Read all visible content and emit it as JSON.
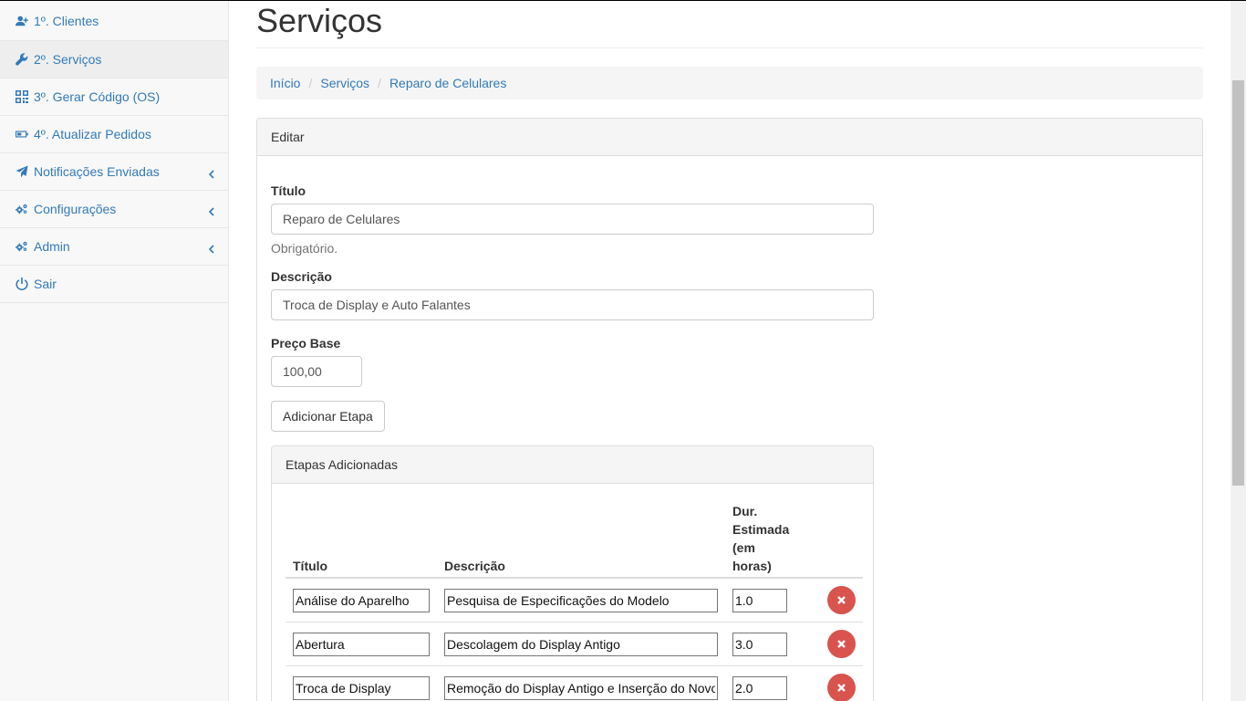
{
  "sidebar": {
    "items": [
      {
        "label": "1º. Clientes",
        "icon": "user-plus-icon",
        "active": false,
        "caret": false
      },
      {
        "label": "2º. Serviços",
        "icon": "wrench-icon",
        "active": true,
        "caret": false
      },
      {
        "label": "3º. Gerar Código (OS)",
        "icon": "qrcode-icon",
        "active": false,
        "caret": false
      },
      {
        "label": "4º. Atualizar Pedidos",
        "icon": "battery-icon",
        "active": false,
        "caret": false
      },
      {
        "label": "Notificações Enviadas",
        "icon": "plane-icon",
        "active": false,
        "caret": true
      },
      {
        "label": "Configurações",
        "icon": "gears-icon",
        "active": false,
        "caret": true
      },
      {
        "label": "Admin",
        "icon": "gears-icon",
        "active": false,
        "caret": true
      },
      {
        "label": "Sair",
        "icon": "power-icon",
        "active": false,
        "caret": false
      }
    ]
  },
  "page": {
    "title": "Serviços"
  },
  "breadcrumb": [
    "Início",
    "Serviços",
    "Reparo de Celulares"
  ],
  "panel": {
    "heading": "Editar"
  },
  "form": {
    "title_label": "Título",
    "title_value": "Reparo de Celulares",
    "title_help": "Obrigatório.",
    "desc_label": "Descrição",
    "desc_value": "Troca de Display e Auto Falantes",
    "price_label": "Preço Base",
    "price_value": "100,00",
    "add_step_button": "Adicionar Etapa"
  },
  "steps_panel": {
    "heading": "Etapas Adicionadas",
    "columns": {
      "title": "Título",
      "description": "Descrição",
      "duration_l1": "Dur.",
      "duration_l2": "Estimada",
      "duration_l3": "(em horas)"
    },
    "rows": [
      {
        "title": "Análise do Aparelho",
        "description": "Pesquisa de Especificações do Modelo",
        "duration": "1.0"
      },
      {
        "title": "Abertura",
        "description": "Descolagem do Display Antigo",
        "duration": "3.0"
      },
      {
        "title": "Troca de Display",
        "description": "Remoção do Display Antigo e Inserção do Novo",
        "duration": "2.0"
      }
    ]
  },
  "colors": {
    "link": "#337ab7",
    "danger": "#d9534f"
  }
}
